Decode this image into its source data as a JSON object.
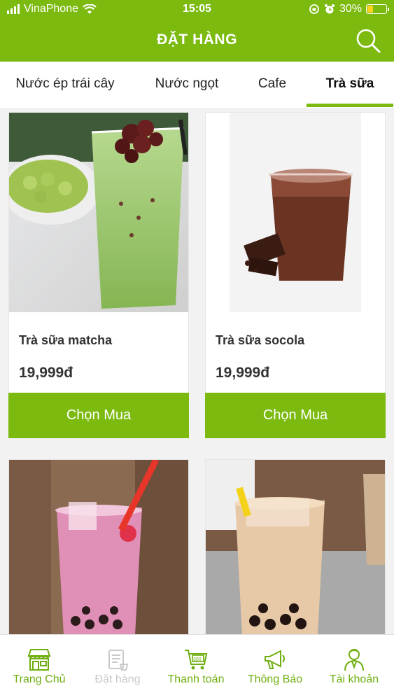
{
  "status_bar": {
    "carrier": "VinaPhone",
    "time": "15:05",
    "battery": "30%",
    "battery_level": 0.3
  },
  "header": {
    "title": "ĐẶT HÀNG",
    "search_icon": "search-icon"
  },
  "tabs": [
    {
      "label": "Nước ép trái cây",
      "active": false
    },
    {
      "label": "Nước ngọt",
      "active": false
    },
    {
      "label": "Cafe",
      "active": false
    },
    {
      "label": "Trà sữa",
      "active": true
    }
  ],
  "products": [
    {
      "name": "Trà sữa matcha",
      "price": "19,999đ",
      "button": "Chọn Mua"
    },
    {
      "name": "Trà sữa socola",
      "price": "19,999đ",
      "button": "Chọn Mua"
    },
    {
      "name": "",
      "price": "",
      "button": ""
    },
    {
      "name": "",
      "price": "",
      "button": ""
    }
  ],
  "bottom_nav": [
    {
      "label": "Trang Chủ",
      "icon": "store-icon",
      "active": true
    },
    {
      "label": "Đặt hàng",
      "icon": "order-icon",
      "active": false
    },
    {
      "label": "Thanh toán",
      "icon": "cart-icon",
      "active": true
    },
    {
      "label": "Thông Báo",
      "icon": "megaphone-icon",
      "active": true
    },
    {
      "label": "Tài khoản",
      "icon": "user-icon",
      "active": true
    }
  ],
  "colors": {
    "brand": "#7cba10",
    "battery": "#ffd21f"
  }
}
